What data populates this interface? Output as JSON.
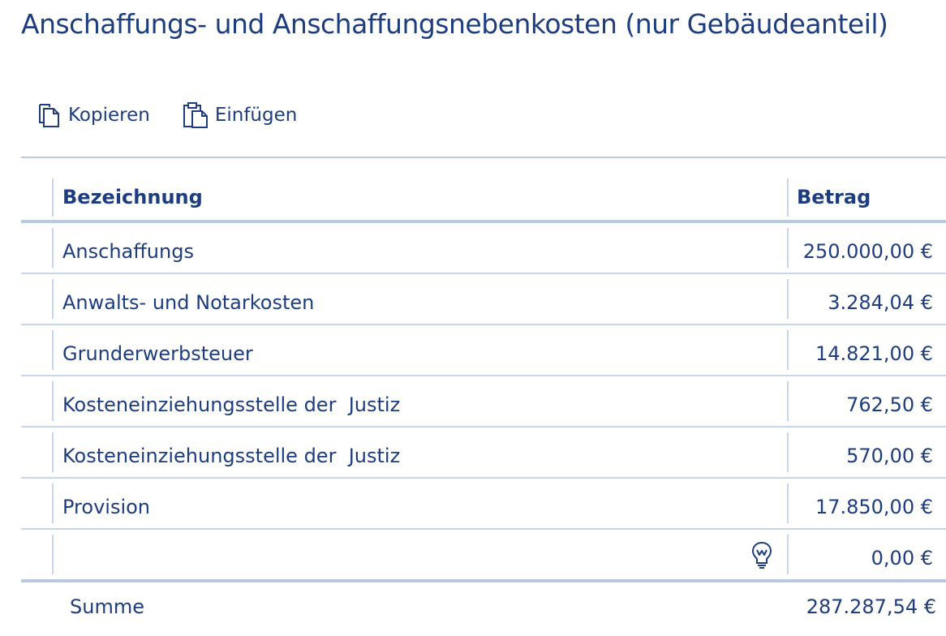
{
  "page": {
    "title": "Anschaffungs- und Anschaffungsnebenkosten (nur Gebäudeanteil)"
  },
  "toolbar": {
    "copy_label": "Kopieren",
    "paste_label": "Einfügen"
  },
  "table": {
    "headers": {
      "name": "Bezeichnung",
      "amount": "Betrag"
    },
    "rows": [
      {
        "name": "Anschaffungs",
        "amount": "250.000,00 €"
      },
      {
        "name": "Anwalts- und Notarkosten",
        "amount": "3.284,04 €"
      },
      {
        "name": "Grunderwerbsteuer",
        "amount": "14.821,00 €"
      },
      {
        "name": "Kosteneinziehungsstelle der  Justiz",
        "amount": "762,50 €"
      },
      {
        "name": "Kosteneinziehungsstelle der  Justiz",
        "amount": "570,00 €"
      },
      {
        "name": "Provision",
        "amount": "17.850,00 €"
      },
      {
        "name": "",
        "amount": "0,00 €",
        "icon": "lightbulb-icon"
      }
    ],
    "sum": {
      "label": "Summe",
      "value": "287.287,54 €"
    }
  },
  "colors": {
    "text": "#1d3d80",
    "rule": "#c7d6e8",
    "rule_strong": "#b8cae0"
  }
}
